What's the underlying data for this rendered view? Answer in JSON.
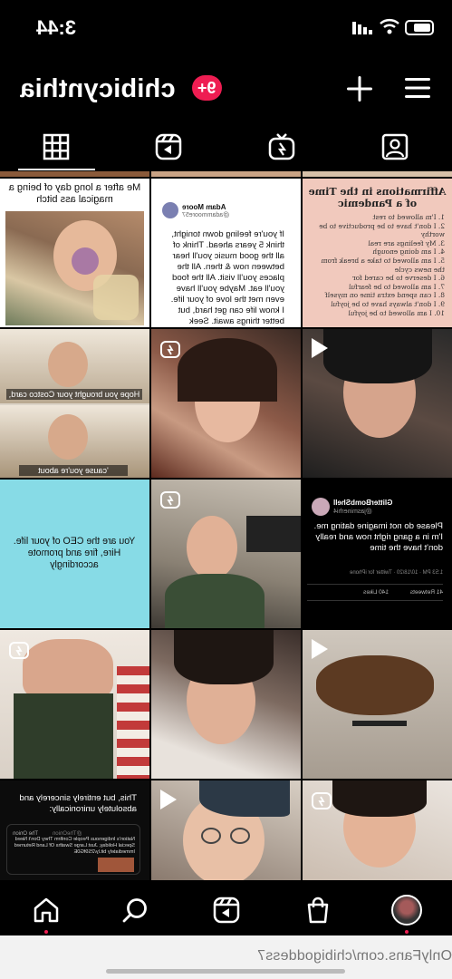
{
  "status_bar": {
    "time": "3:44"
  },
  "profile": {
    "username": "chibicynthia",
    "notification_badge": "9+"
  },
  "tabs": [
    {
      "name": "grid",
      "icon": "grid-icon",
      "active": true
    },
    {
      "name": "reels",
      "icon": "reels-icon",
      "active": false
    },
    {
      "name": "igtv",
      "icon": "igtv-icon",
      "active": false
    },
    {
      "name": "tagged",
      "icon": "tagged-user-icon",
      "active": false
    }
  ],
  "posts": {
    "p1": {
      "caption": "Me after a long day of being a magical ass bitch"
    },
    "p2": {
      "author": "Adam Moore",
      "handle": "@adammoore57",
      "body": "If you're feeling down tonight, think 5 years ahead. Think of all the good music you'll hear between now & then. All the places you'll visit. All the food you'll eat. Maybe you'll have even met the love of your life. I know life can get hard, but better things await. Seek hope."
    },
    "p3": {
      "title": "Affirmations in the Time of a Pandemic",
      "items": [
        "1. I'm allowed to rest",
        "2. I don't have to be productive to be worthy",
        "3. My feelings are real",
        "4. I am doing enough",
        "5. I am allowed to take a break from the news cycle",
        "6. I deserve to be cared for",
        "7. I am allowed to be fearful",
        "8. I can spend extra time on myself",
        "9. I don't always have to be joyful",
        "10. I am allowed to be joyful"
      ]
    },
    "p4": {
      "caption_top": "Hope you brought your Costco card,",
      "caption_bottom": "'cause you're about"
    },
    "p7": {
      "text": "You are the CEO of your life. Hire, fire and promote accordingly"
    },
    "p9": {
      "author": "GlitterBombShell",
      "handle": "@jasminerhi4",
      "body": "Please do not imagine dating me. I'm in a gang right now and really don't have the time",
      "meta": "1:53 PM · 10/18/20 · Twitter for iPhone",
      "retweets": "41 Retweets",
      "likes": "140 Likes"
    },
    "p15": {
      "body": "This, but entirely sincerely and absolutely unironically:",
      "source": "The Onion",
      "source_handle": "@TheOnion",
      "headline": "Nation's Indigenous People Confirm They Don't Need Special Holiday, Just Large Swaths Of Land Returned Immediately bit.ly/2S9fG0E"
    }
  },
  "bottom_nav": [
    {
      "name": "home",
      "icon": "home-icon"
    },
    {
      "name": "search",
      "icon": "search-icon"
    },
    {
      "name": "reels",
      "icon": "reels-icon"
    },
    {
      "name": "shop",
      "icon": "shop-bag-icon"
    },
    {
      "name": "profile",
      "icon": "avatar"
    }
  ],
  "watermark": "OnlyFans.com/chibigoddess7"
}
